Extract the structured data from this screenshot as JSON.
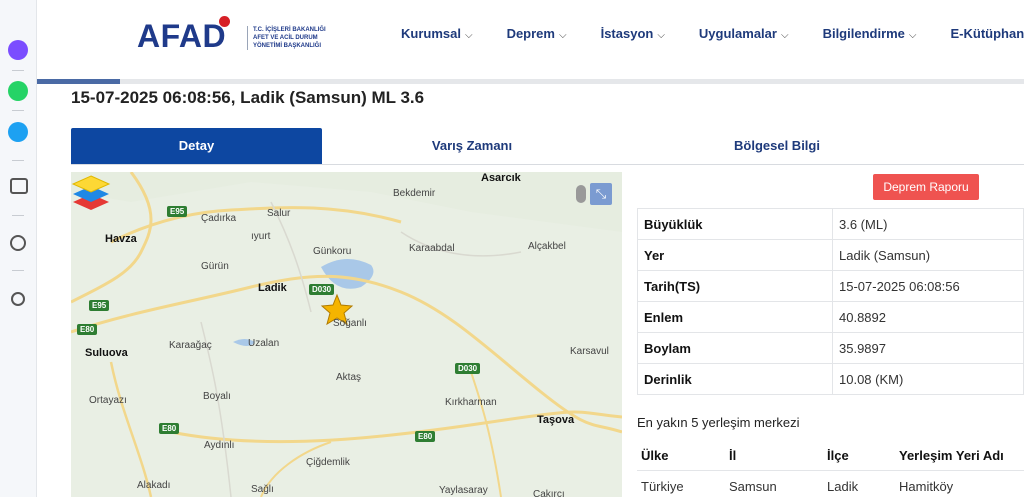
{
  "header": {
    "logo": "AFAD",
    "logo_sub": [
      "T.C. İÇİŞLERİ BAKANLIĞI",
      "AFET VE ACİL DURUM",
      "YÖNETİMİ BAŞKANLIĞI"
    ],
    "nav": [
      "Kurumsal",
      "Deprem",
      "İstasyon",
      "Uygulamalar",
      "Bilgilendirme",
      "E-Kütüphane"
    ]
  },
  "event": {
    "title": "15-07-2025 06:08:56, Ladik (Samsun) ML 3.6"
  },
  "tabs": [
    "Detay",
    "Varış Zamanı",
    "Bölgesel Bilgi"
  ],
  "map": {
    "towns": [
      "Asarcık",
      "Bekdemir",
      "Havza",
      "Çadırka",
      "Salur",
      "ıyurt",
      "Günkoru",
      "Karaabdal",
      "Alçakbel",
      "Gürün",
      "Ladik",
      "Soğanlı",
      "Suluova",
      "Karaağaç",
      "Uzalan",
      "Karsavul",
      "Aktaş",
      "Ortayazı",
      "Boyalı",
      "Kırkharman",
      "Taşova",
      "Aydınlı",
      "Çiğdemlik",
      "Alakadı",
      "Sağlı",
      "Yaylasaray",
      "Çakırcı"
    ],
    "roads": [
      "E95",
      "E95",
      "E80",
      "E80",
      "E80",
      "D030",
      "D030"
    ],
    "expand_icon": "expand-icon",
    "layers_icon": "layers-icon"
  },
  "report_button": "Deprem Raporu",
  "info": [
    {
      "k": "Büyüklük",
      "v": "3.6 (ML)"
    },
    {
      "k": "Yer",
      "v": "Ladik (Samsun)"
    },
    {
      "k": "Tarih(TS)",
      "v": "15-07-2025 06:08:56"
    },
    {
      "k": "Enlem",
      "v": "40.8892"
    },
    {
      "k": "Boylam",
      "v": "35.9897"
    },
    {
      "k": "Derinlik",
      "v": "10.08 (KM)"
    }
  ],
  "nearest": {
    "title": "En yakın 5 yerleşim merkezi",
    "headers": [
      "Ülke",
      "İl",
      "İlçe",
      "Yerleşim Yeri Adı"
    ],
    "rows": [
      [
        "Türkiye",
        "Samsun",
        "Ladik",
        "Hamitköy"
      ]
    ]
  },
  "colors": {
    "brand": "#1f3a8a",
    "tab_active": "#0d47a1",
    "report": "#ef5350",
    "road_shield": "#2e7d32"
  }
}
